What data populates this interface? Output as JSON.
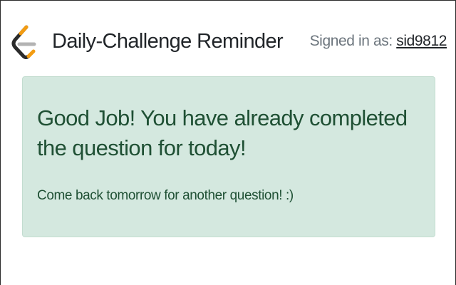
{
  "header": {
    "logo_icon": "leetcode-logo-icon",
    "title": "Daily-Challenge Reminder",
    "signed_in_label": "Signed in as: ",
    "username": "sid9812"
  },
  "alert": {
    "heading": "Good Job! You have already completed the question for today!",
    "message": "Come back tomorrow for another question! :)"
  },
  "colors": {
    "alert_background": "#d4e8df",
    "alert_text": "#1f5034",
    "logo_orange": "#f39c12",
    "logo_gray": "#b3b3b3",
    "logo_dark": "#2b2b2b"
  }
}
